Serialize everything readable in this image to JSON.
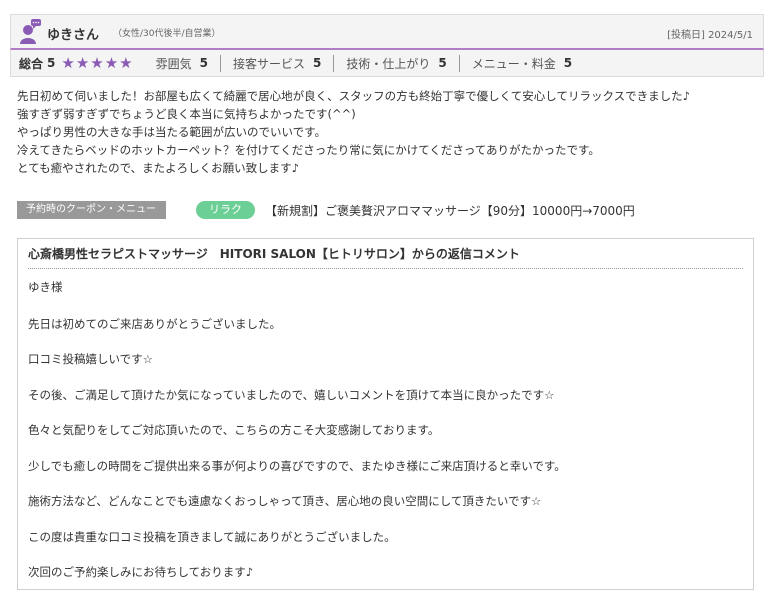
{
  "reviewer": {
    "name": "ゆきさん",
    "meta": "（女性/30代後半/自営業）",
    "avatar_icon": "user-avatar-speech-icon",
    "avatar_color": "#8a5bb4"
  },
  "post_date": "[投稿日] 2024/5/1",
  "rating": {
    "overall_label": "総合",
    "overall_score": "5",
    "stars": "★★★★★",
    "star_count": 5,
    "star_color": "#8a5bb4",
    "categories": [
      {
        "name": "雰囲気",
        "value": "5"
      },
      {
        "name": "接客サービス",
        "value": "5"
      },
      {
        "name": "技術・仕上がり",
        "value": "5"
      },
      {
        "name": "メニュー・料金",
        "value": "5"
      }
    ]
  },
  "review_lines": [
    "先日初めて伺いました！お部屋も広くて綺麗で居心地が良く、スタッフの方も終始丁寧で優しくて安心してリラックスできました♪",
    "強すぎず弱すぎずでちょうど良く本当に気持ちよかったです(^^)",
    "やっぱり男性の大きな手は当たる範囲が広いのでいいです。",
    "冷えてきたらベッドのホットカーペット？を付けてくださったり常に気にかけてくださってありがたかったです。",
    "とても癒やされたので、またよろしくお願い致します♪"
  ],
  "coupon": {
    "label": "予約時のクーポン・メニュー",
    "tag": "リラク",
    "tag_color": "#6ccf96",
    "text": "【新規割】ご褒美贅沢アロママッサージ【90分】10000円→7000円"
  },
  "reply": {
    "title": "心斎橋男性セラピストマッサージ　HITORI SALON【ヒトリサロン】からの返信コメント",
    "lines": [
      "ゆき様",
      "先日は初めてのご来店ありがとうございました。",
      "口コミ投稿嬉しいです☆",
      "その後、ご満足して頂けたか気になっていましたので、嬉しいコメントを頂けて本当に良かったです☆",
      "色々と気配りをしてご対応頂いたので、こちらの方こそ大変感謝しております。",
      "少しでも癒しの時間をご提供出来る事が何よりの喜びですので、またゆき様にご来店頂けると幸いです。",
      "施術方法など、どんなことでも遠慮なくおっしゃって頂き、居心地の良い空間にして頂きたいです☆",
      "この度は貴重な口コミ投稿を頂きまして誠にありがとうございました。",
      "次回のご予約楽しみにお待ちしております♪"
    ]
  }
}
